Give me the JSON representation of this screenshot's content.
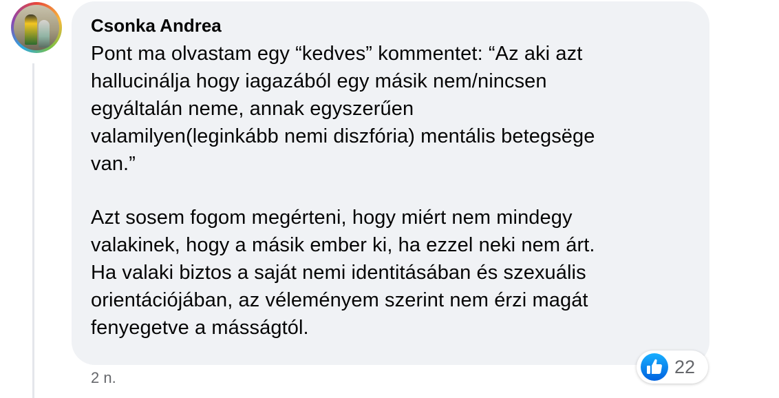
{
  "comment": {
    "author": "Csonka Andrea",
    "paragraphs": [
      {
        "lines": [
          "Pont ma olvastam egy “kedves” kommentet: “Az aki azt",
          "hallucinálja hogy iagazából egy másik nem/nincsen",
          "egyáltalán neme, annak egyszerűen",
          "valamilyen(leginkább nemi diszfória) mentális betegsëge",
          "van.”"
        ]
      },
      {
        "lines": [
          "Azt sosem fogom megérteni, hogy miért nem mindegy",
          "valakinek, hogy a másik ember ki, ha ezzel neki nem árt.",
          "Ha valaki biztos a saját nemi identitásában és szexuális",
          "orientációjában, az véleményem szerint nem érzi magát",
          "fenyegetve a másságtól."
        ]
      }
    ],
    "timestamp": "2 n.",
    "reactions": {
      "icon": "like-icon",
      "count": "22"
    }
  },
  "colors": {
    "bubble_bg": "#f0f2f5",
    "text": "#050505",
    "secondary_text": "#65676b",
    "like_blue": "#1877f2"
  }
}
